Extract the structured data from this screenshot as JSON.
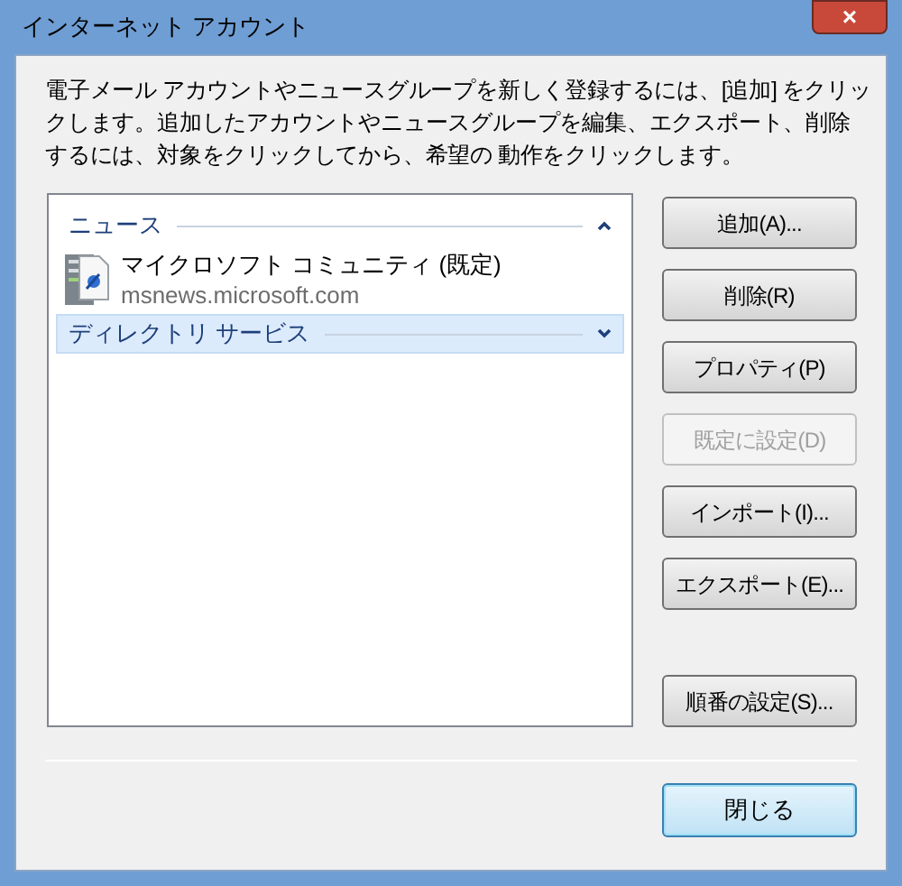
{
  "window": {
    "title": "インターネット アカウント",
    "close": "×"
  },
  "description": "電子メール アカウントやニュースグループを新しく登録するには、[追加] をクリックします。追加したアカウントやニュースグループを編集、エクスポート、削除するには、対象をクリックしてから、希望の 動作をクリックします。",
  "groups": [
    {
      "label": "ニュース",
      "expanded": true,
      "selected": false,
      "items": [
        {
          "name": "マイクロソフト コミュニティ (既定)",
          "address": "msnews.microsoft.com"
        }
      ]
    },
    {
      "label": "ディレクトリ サービス",
      "expanded": false,
      "selected": true
    }
  ],
  "buttons": [
    {
      "label": "追加(A)...",
      "disabled": false
    },
    {
      "label": "削除(R)",
      "disabled": false
    },
    {
      "label": "プロパティ(P)",
      "disabled": false
    },
    {
      "label": "既定に設定(D)",
      "disabled": true
    },
    {
      "label": "インポート(I)...",
      "disabled": false
    },
    {
      "label": "エクスポート(E)...",
      "disabled": false
    },
    {
      "label": "順番の設定(S)...",
      "disabled": false
    }
  ],
  "close_button": "閉じる"
}
